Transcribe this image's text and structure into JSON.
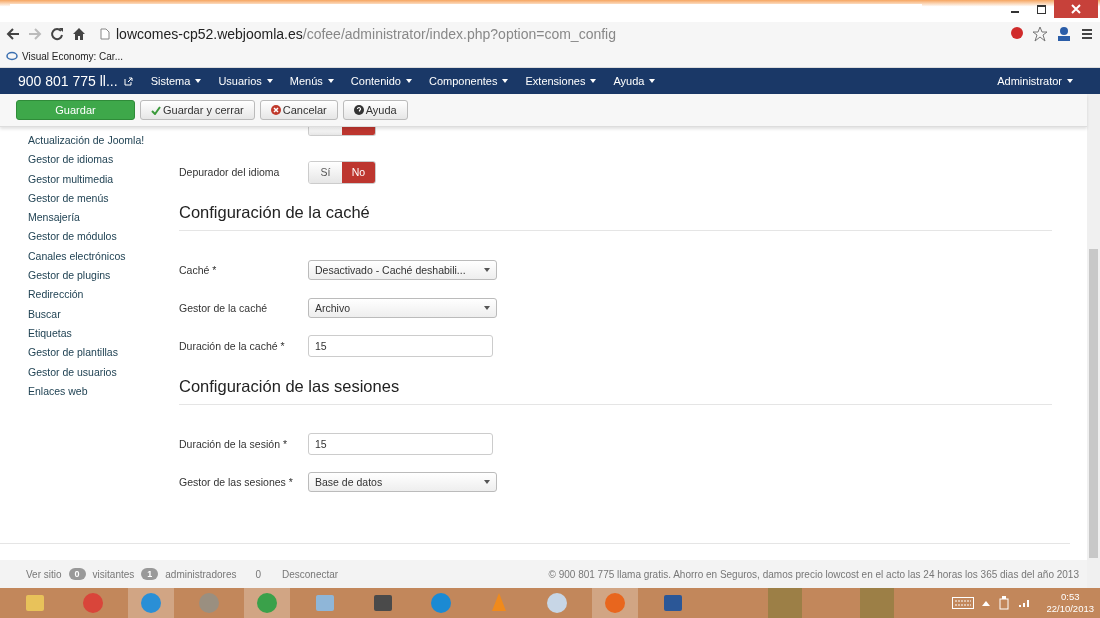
{
  "browser": {
    "url_host": "lowcomes-cp52.webjoomla.es",
    "url_path": "/cofee/administrator/index.php?option=com_config",
    "bookmarks": [
      "Visual Economy: Car..."
    ]
  },
  "navbar": {
    "brand": "900 801 775 ll...",
    "menus": [
      "Sistema",
      "Usuarios",
      "Menús",
      "Contenido",
      "Componentes",
      "Extensiones",
      "Ayuda"
    ],
    "user": "Administrator"
  },
  "toolbar": [
    {
      "label": "Guardar",
      "kind": "primary"
    },
    {
      "label": "Guardar y cerrar",
      "kind": "check"
    },
    {
      "label": "Cancelar",
      "kind": "cancel"
    },
    {
      "label": "Ayuda",
      "kind": "help"
    }
  ],
  "sidebar": {
    "items": [
      "Actualización de Joomla!",
      "Gestor de idiomas",
      "Gestor multimedia",
      "Gestor de menús",
      "Mensajería",
      "Gestor de módulos",
      "Canales electrónicos",
      "Gestor de plugins",
      "Redirección",
      "Buscar",
      "Etiquetas",
      "Gestor de plantillas",
      "Gestor de usuarios",
      "Enlaces web"
    ]
  },
  "form": [
    {
      "kind": "toggle",
      "options": [
        {
          "selected": false
        },
        {
          "selected": true
        }
      ]
    },
    {
      "kind": "toggle",
      "label": "Depurador del idioma",
      "options": [
        {
          "label": "Sí",
          "selected": false
        },
        {
          "label": "No",
          "selected": true
        }
      ]
    },
    {
      "kind": "heading",
      "label": "Configuración de la caché"
    },
    {
      "kind": "select",
      "label": "Caché *",
      "value": "Desactivado - Caché deshabili..."
    },
    {
      "kind": "select",
      "label": "Gestor de la caché",
      "value": "Archivo"
    },
    {
      "kind": "input",
      "label": "Duración de la caché *",
      "value": "15"
    },
    {
      "kind": "heading",
      "label": "Configuración de las sesiones"
    },
    {
      "kind": "input",
      "label": "Duración de la sesión *",
      "value": "15"
    },
    {
      "kind": "select",
      "label": "Gestor de las sesiones *",
      "value": "Base de datos"
    }
  ],
  "footer": {
    "view_site": "Ver sitio",
    "visitors_count": "0",
    "visitors": "visitantes",
    "admins_count": "1",
    "admins": "administradores",
    "messages": "0",
    "logout": "Desconectar",
    "copyright": "© 900 801 775 llama gratis. Ahorro en Seguros, damos precio lowcost en el acto las 24 horas los 365 dias del año 2013"
  },
  "taskbar": {
    "time": "0:53",
    "date": "22/10/2013"
  }
}
